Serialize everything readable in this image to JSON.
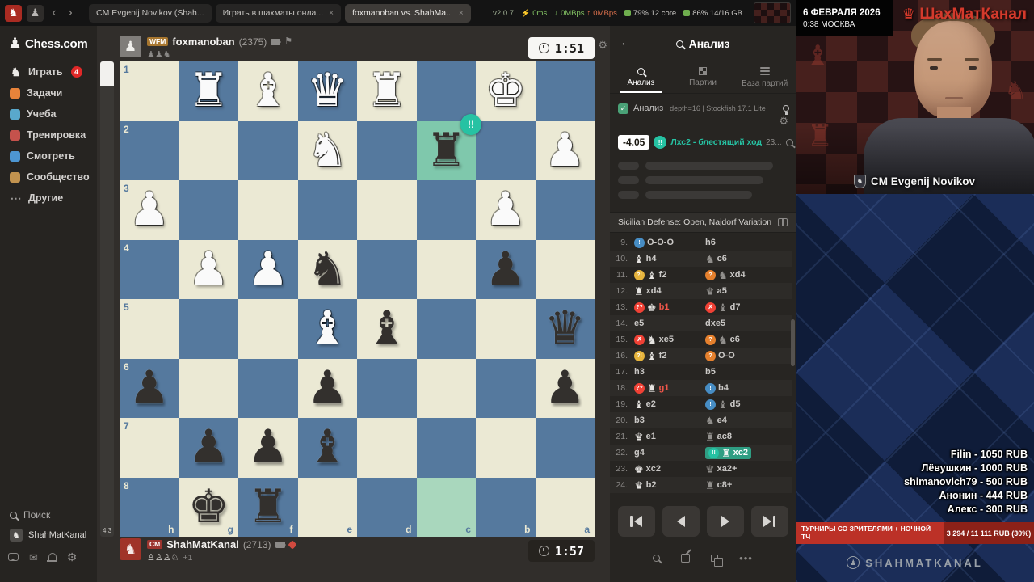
{
  "browser": {
    "tabs": [
      {
        "title": "CM Evgenij Novikov (Shah...",
        "active": false,
        "closable": false
      },
      {
        "title": "Играть в шахматы онла...",
        "active": false,
        "closable": true
      },
      {
        "title": "foxmanoban vs. ShahMa...",
        "active": true,
        "closable": true
      }
    ],
    "stats": {
      "version": "v2.0.7",
      "latency": "0ms",
      "down": "0MBps",
      "up": "0MBps",
      "cpu": "79% 12 core",
      "ram": "86% 14/16 GB"
    }
  },
  "sidebar": {
    "logo_text": "Chess.com",
    "items": [
      {
        "label": "Играть",
        "icon": "play-knight-icon",
        "glyph": "♞",
        "color": "#eceae7",
        "badge": "4"
      },
      {
        "label": "Задачи",
        "icon": "puzzles-icon",
        "color": "#e8833a"
      },
      {
        "label": "Учеба",
        "icon": "lessons-icon",
        "color": "#59a8cc"
      },
      {
        "label": "Тренировка",
        "icon": "drills-icon",
        "color": "#c5524c"
      },
      {
        "label": "Смотреть",
        "icon": "watch-icon",
        "color": "#4d96d2"
      },
      {
        "label": "Сообщество",
        "icon": "community-icon",
        "color": "#c2934f"
      },
      {
        "label": "Другие",
        "icon": "more-icon",
        "glyph": "⋯",
        "color": "#9b9997"
      }
    ],
    "search_label": "Поиск",
    "username": "ShahMatKanal"
  },
  "players": {
    "top": {
      "title": "WFM",
      "name": "foxmanoban",
      "rating": "(2375)",
      "captured": "♟♟♞",
      "clock": "1:51"
    },
    "bottom": {
      "title": "CM",
      "name": "ShahMatKanal",
      "rating": "(2713)",
      "captured": "♙♙♙♘",
      "material": "+1",
      "clock": "1:57"
    }
  },
  "evalbar": {
    "label": "4.3"
  },
  "board": {
    "files": [
      "h",
      "g",
      "f",
      "e",
      "d",
      "c",
      "b",
      "a"
    ],
    "ranks": [
      "1",
      "2",
      "3",
      "4",
      "5",
      "6",
      "7",
      "8"
    ],
    "pieces": [
      {
        "sq": "g1",
        "p": "wR"
      },
      {
        "sq": "f1",
        "p": "wB"
      },
      {
        "sq": "e1",
        "p": "wQ"
      },
      {
        "sq": "d1",
        "p": "wR"
      },
      {
        "sq": "b1",
        "p": "wK"
      },
      {
        "sq": "e2",
        "p": "wN"
      },
      {
        "sq": "c2",
        "p": "bR"
      },
      {
        "sq": "a2",
        "p": "wP"
      },
      {
        "sq": "h3",
        "p": "wP"
      },
      {
        "sq": "b3",
        "p": "wP"
      },
      {
        "sq": "g4",
        "p": "wP"
      },
      {
        "sq": "f4",
        "p": "wP"
      },
      {
        "sq": "e4",
        "p": "bN"
      },
      {
        "sq": "b4",
        "p": "bP"
      },
      {
        "sq": "e5",
        "p": "wB"
      },
      {
        "sq": "d5",
        "p": "bB"
      },
      {
        "sq": "a5",
        "p": "bQ"
      },
      {
        "sq": "h6",
        "p": "bP"
      },
      {
        "sq": "e6",
        "p": "bP"
      },
      {
        "sq": "a6",
        "p": "bP"
      },
      {
        "sq": "g7",
        "p": "bP"
      },
      {
        "sq": "f7",
        "p": "bP"
      },
      {
        "sq": "e7",
        "p": "bB"
      },
      {
        "sq": "g8",
        "p": "bK"
      },
      {
        "sq": "f8",
        "p": "bR"
      }
    ],
    "highlights": [
      {
        "sq": "c8",
        "color": "#a9d7bd"
      },
      {
        "sq": "c2",
        "color": "#7fc8ac"
      }
    ],
    "badge": {
      "square": "c2",
      "text": "!!",
      "color": "#26c2a3"
    }
  },
  "glyphs": {
    "figurines": {
      "K": "♚",
      "Q": "♛",
      "R": "♜",
      "B": "♝",
      "N": "♞",
      "P": "♟"
    },
    "badges": {
      "good": "!",
      "brilliant": "!!",
      "inaccuracy": "?!",
      "mistake": "?",
      "blunder": "??",
      "miss": "✗"
    }
  },
  "analysis": {
    "title": "Анализ",
    "tabs": [
      {
        "label": "Анализ",
        "icon": "magnifier",
        "active": true
      },
      {
        "label": "Партии",
        "icon": "board",
        "active": false
      },
      {
        "label": "База партий",
        "icon": "database",
        "active": false
      }
    ],
    "toggle_label": "Анализ",
    "engine_info": "depth=16 | Stockfish 17.1 Lite",
    "eval": "-4.05",
    "move_quality": "Лхс2 - блестящий ход",
    "move_prefix": "23...",
    "opening": "Sicilian Defense: Open, Najdorf Variation",
    "moves": [
      {
        "n": "9.",
        "w": {
          "t": "O-O-O",
          "badge": "good"
        },
        "b": {
          "t": "h6"
        }
      },
      {
        "n": "10.",
        "w": {
          "t": "h4",
          "fig": "B"
        },
        "b": {
          "t": "c6",
          "fig": "N"
        }
      },
      {
        "n": "11.",
        "w": {
          "t": "f2",
          "fig": "B",
          "badge": "inaccuracy"
        },
        "b": {
          "t": "xd4",
          "fig": "N",
          "badge": "mistake"
        }
      },
      {
        "n": "12.",
        "w": {
          "t": "xd4",
          "fig": "R"
        },
        "b": {
          "t": "a5",
          "fig": "Q"
        }
      },
      {
        "n": "13.",
        "w": {
          "t": "b1",
          "fig": "K",
          "badge": "blunder",
          "red": true
        },
        "b": {
          "t": "d7",
          "fig": "B",
          "badge": "miss"
        }
      },
      {
        "n": "14.",
        "w": {
          "t": "e5"
        },
        "b": {
          "t": "dxe5"
        }
      },
      {
        "n": "15.",
        "w": {
          "t": "xe5",
          "fig": "N",
          "badge": "miss"
        },
        "b": {
          "t": "c6",
          "fig": "N",
          "badge": "mistake"
        }
      },
      {
        "n": "16.",
        "w": {
          "t": "f2",
          "fig": "B",
          "badge": "inaccuracy"
        },
        "b": {
          "t": "O-O",
          "badge": "mistake"
        }
      },
      {
        "n": "17.",
        "w": {
          "t": "h3"
        },
        "b": {
          "t": "b5"
        }
      },
      {
        "n": "18.",
        "w": {
          "t": "g1",
          "fig": "R",
          "badge": "blunder",
          "red": true
        },
        "b": {
          "t": "b4",
          "badge": "good"
        }
      },
      {
        "n": "19.",
        "w": {
          "t": "e2",
          "fig": "B"
        },
        "b": {
          "t": "d5",
          "fig": "B",
          "badge": "good"
        }
      },
      {
        "n": "20.",
        "w": {
          "t": "b3"
        },
        "b": {
          "t": "e4",
          "fig": "N"
        }
      },
      {
        "n": "21.",
        "w": {
          "t": "e1",
          "fig": "Q"
        },
        "b": {
          "t": "ac8",
          "fig": "R"
        }
      },
      {
        "n": "22.",
        "w": {
          "t": "g4"
        },
        "b": {
          "t": "xc2",
          "fig": "R",
          "badge": "brilliant",
          "current": true
        }
      },
      {
        "n": "23.",
        "w": {
          "t": "xc2",
          "fig": "K"
        },
        "b": {
          "t": "xa2+",
          "fig": "Q"
        }
      },
      {
        "n": "24.",
        "w": {
          "t": "b2",
          "fig": "Q"
        },
        "b": {
          "t": "c8+",
          "fig": "R"
        }
      }
    ]
  },
  "stream": {
    "date": "6 ФЕВРАЛЯ 2026",
    "time": "0:38 МОСКВА",
    "channel": "ШахМатКанал",
    "caster": "CM Evgenij Novikov",
    "donations": [
      "Filin - 1050 RUB",
      "Лёвушкин - 1000 RUB",
      "shimanovich79 - 500 RUB",
      "Анонин - 444 RUB",
      "Алекс - 300 RUB"
    ],
    "banner_title": "ТУРНИРЫ СО ЗРИТЕЛЯМИ + НОЧНОЙ ТЧ",
    "banner_value": "3 294 / 11 111 RUB (30%)",
    "watermark": "SHAHMATKANAL"
  }
}
